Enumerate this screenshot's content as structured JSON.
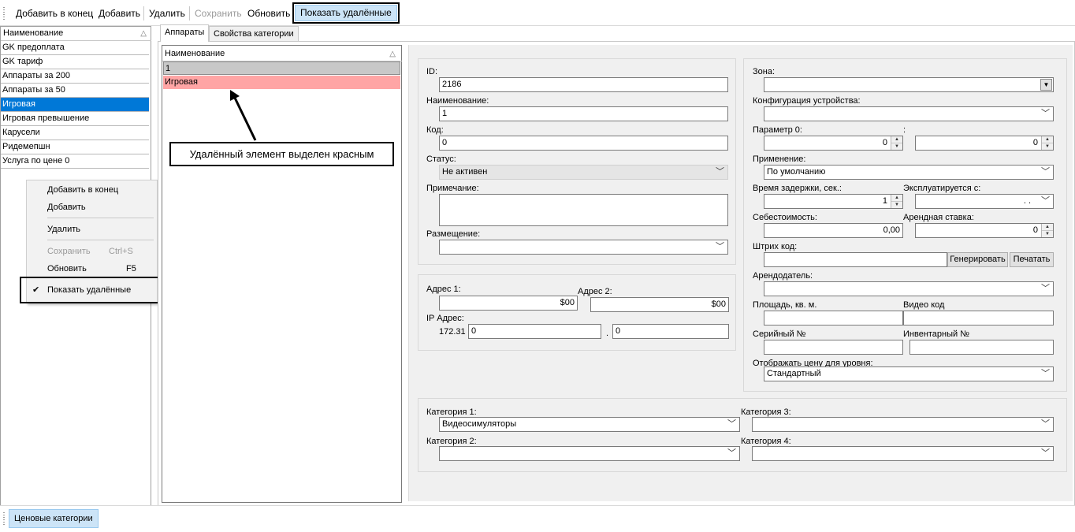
{
  "toolbar": {
    "add_to_end": "Добавить в конец",
    "add": "Добавить",
    "delete": "Удалить",
    "save": "Сохранить",
    "refresh": "Обновить",
    "show_deleted": "Показать удалённые"
  },
  "left_list": {
    "header": "Наименование",
    "sort_icon": "sort-ascending-icon",
    "rows": [
      "GK  предоплата",
      "GK тариф",
      "Аппараты за 200",
      "Аппараты за 50",
      "Игровая",
      "Игровая превышение",
      "Карусели",
      "Ридемепшн",
      "Услуга по цене 0"
    ],
    "selected_index": 4
  },
  "context_menu": {
    "add_to_end": "Добавить в конец",
    "add": "Добавить",
    "delete": "Удалить",
    "save": "Сохранить",
    "save_shortcut": "Ctrl+S",
    "refresh": "Обновить",
    "refresh_shortcut": "F5",
    "show_deleted": "Показать удалённые",
    "show_deleted_checked": true
  },
  "tabs": [
    "Аппараты",
    "Свойства категории"
  ],
  "device_list": {
    "header": "Наименование",
    "rows": [
      "1",
      "Игровая"
    ]
  },
  "annotation": "Удалённый элемент выделен красным",
  "form": {
    "id_label": "ID:",
    "id_value": "2186",
    "name_label": "Наименование:",
    "name_value": "1",
    "code_label": "Код:",
    "code_value": "0",
    "status_label": "Статус:",
    "status_value": "Не активен",
    "note_label": "Примечание:",
    "note_value": "",
    "placement_label": "Размещение:",
    "placement_value": "",
    "address1_label": "Адрес 1:",
    "address1_value": "$00",
    "address2_label": "Адрес 2:",
    "address2_value": "$00",
    "ip_label": "IP Адрес:",
    "ip_prefix": "172.31",
    "ip_part1": "0",
    "ip_dot": ".",
    "ip_part2": "0",
    "zone_label": "Зона:",
    "zone_value": "",
    "config_label": "Конфигурация устройства:",
    "config_value": "",
    "param0_label": "Параметр 0:",
    "param0_value": "0",
    "param0_colon": ":",
    "param0b_value": "0",
    "usage_label": "Применение:",
    "usage_value": "По умолчанию",
    "delay_label": "Время задержки, сек.:",
    "delay_value": "1",
    "operated_label": "Эксплуатируется с:",
    "operated_value": ".  .",
    "cost_label": "Себестоимость:",
    "cost_value": "0,00",
    "rent_label": "Арендная ставка:",
    "rent_value": "0",
    "barcode_label": "Штрих код:",
    "barcode_value": "",
    "generate_btn": "Генерировать",
    "print_btn": "Печатать",
    "landlord_label": "Арендодатель:",
    "landlord_value": "",
    "area_label": "Площадь, кв. м.",
    "area_value": "",
    "video_label": "Видео код",
    "video_value": "",
    "serial_label": "Серийный №",
    "serial_value": "",
    "inventory_label": "Инвентарный №",
    "inventory_value": "",
    "price_level_label": "Отображать цену для уровня:",
    "price_level_value": "Стандартный",
    "cat1_label": "Категория 1:",
    "cat1_value": "Видеосимуляторы",
    "cat2_label": "Категория 2:",
    "cat2_value": "",
    "cat3_label": "Категория 3:",
    "cat3_value": "",
    "cat4_label": "Категория 4:",
    "cat4_value": ""
  },
  "status_bar": {
    "button": "Ценовые категории"
  },
  "colors": {
    "selection": "#0078d7",
    "deleted_row": "#ffa5a5",
    "active_button": "#cce4f7"
  }
}
